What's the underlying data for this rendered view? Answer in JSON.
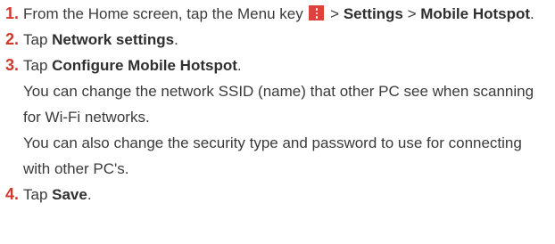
{
  "steps": [
    {
      "num": "1.",
      "text_a": "From the Home screen, tap the Menu key",
      "text_b": " > ",
      "bold_a": "Settings",
      "text_c": " > ",
      "bold_b": "Mobile Hotspot",
      "text_d": "."
    },
    {
      "num": "2.",
      "text_a": "Tap ",
      "bold_a": "Network settings",
      "text_b": "."
    },
    {
      "num": "3.",
      "text_a": "Tap ",
      "bold_a": "Configure Mobile Hotspot",
      "text_b": ".",
      "para_1": "You can change the network SSID (name) that other PC see when scanning for Wi-Fi networks.",
      "para_2": "You can also change the security type and password to use for connecting with other PC's."
    },
    {
      "num": "4.",
      "text_a": "Tap ",
      "bold_a": "Save",
      "text_b": "."
    }
  ],
  "icons": {
    "menu_key": "menu-key-icon",
    "menu_key_color": "#e0413a",
    "number_color": "#d03a2c"
  }
}
